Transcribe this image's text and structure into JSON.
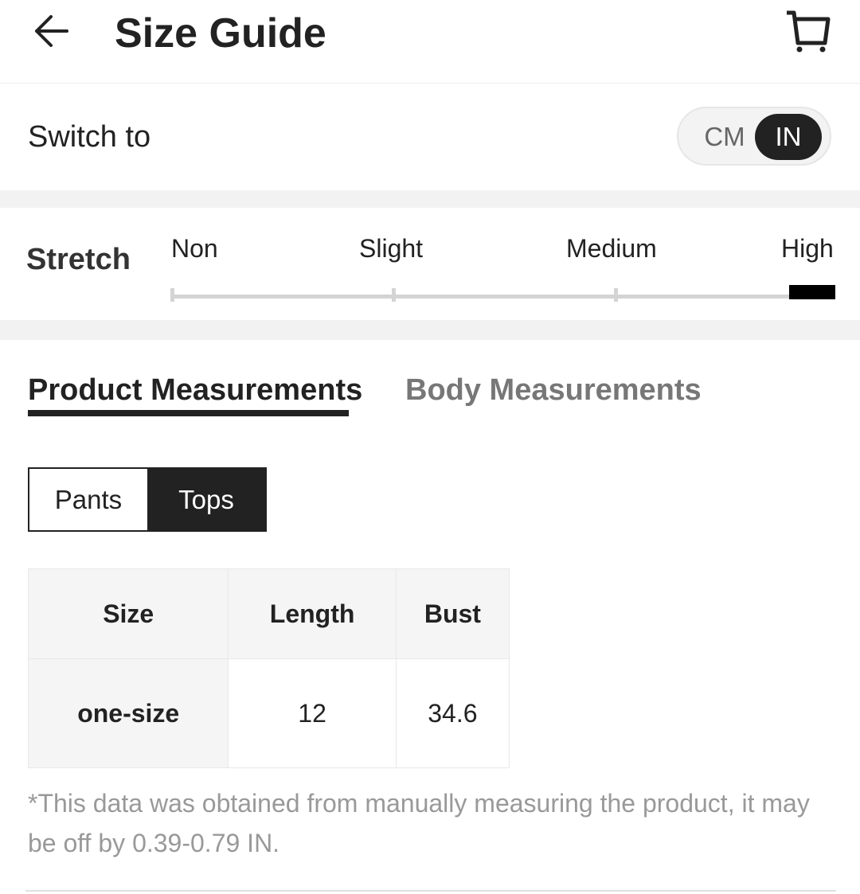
{
  "header": {
    "title": "Size Guide",
    "back_icon": "arrow-left-icon",
    "cart_icon": "shopping-cart-icon"
  },
  "units": {
    "label": "Switch to",
    "options": [
      "CM",
      "IN"
    ],
    "selected": "IN"
  },
  "stretch": {
    "label": "Stretch",
    "levels": [
      "Non",
      "Slight",
      "Medium",
      "High"
    ],
    "selected": "High"
  },
  "tabs": [
    {
      "label": "Product Measurements",
      "active": true
    },
    {
      "label": "Body Measurements",
      "active": false
    }
  ],
  "categories": {
    "items": [
      "Pants",
      "Tops"
    ],
    "selected": "Tops"
  },
  "table": {
    "headers": [
      "Size",
      "Length",
      "Bust"
    ],
    "rows": [
      [
        "one-size",
        "12",
        "34.6"
      ]
    ]
  },
  "note": "*This data was obtained from manually measuring the product, it may be off by 0.39-0.79 IN.",
  "colors": {
    "accent": "#222222",
    "muted": "#999999",
    "track": "#d4d4d4"
  }
}
